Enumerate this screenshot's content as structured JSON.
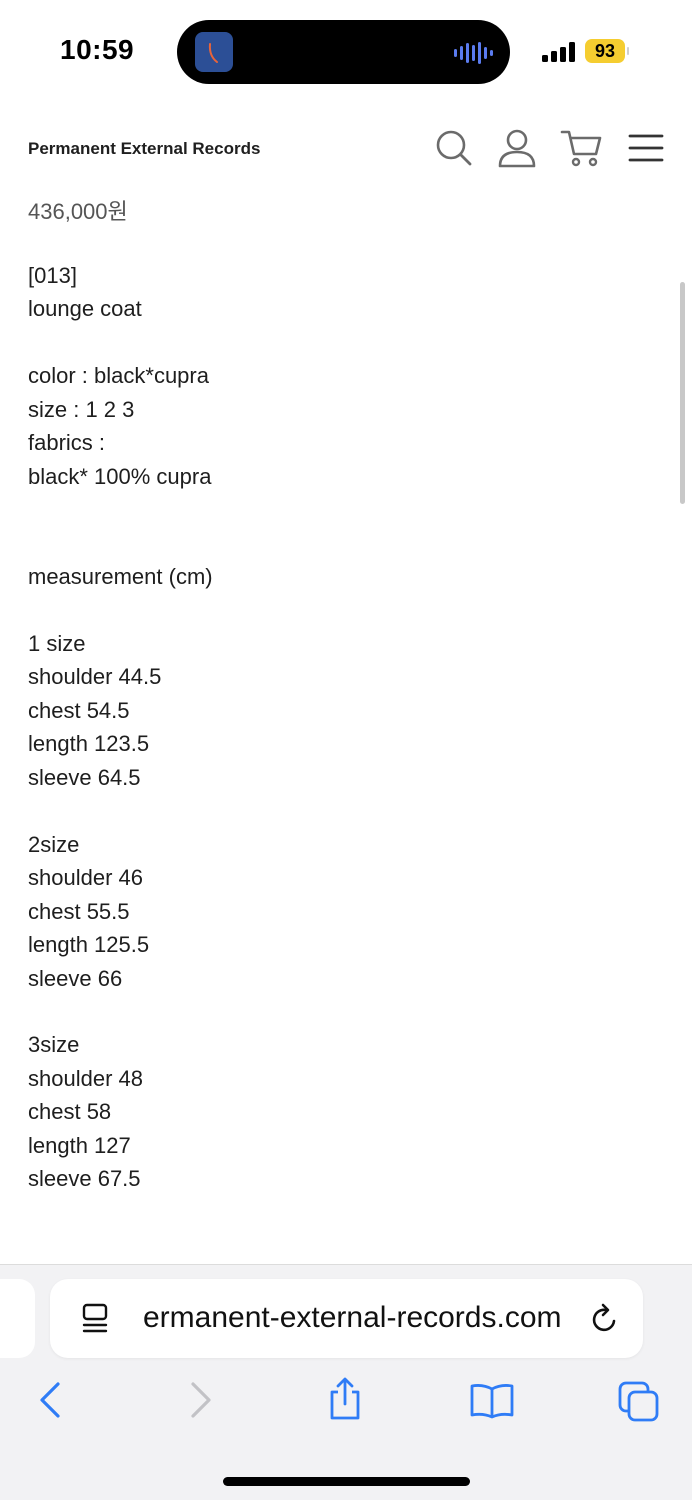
{
  "status_bar": {
    "time": "10:59",
    "battery": "93"
  },
  "header": {
    "brand": "Permanent External Records",
    "icons": [
      "search-icon",
      "account-icon",
      "cart-icon",
      "menu-icon"
    ]
  },
  "product": {
    "price": "436,000원",
    "code": "[013]",
    "name": "lounge coat",
    "color": "color : black*cupra",
    "size": "size : 1 2 3",
    "fabrics_label": "fabrics :",
    "fabrics": "black* 100% cupra",
    "measurement_title": "measurement (cm)",
    "size1": {
      "title": "1 size",
      "shoulder": "shoulder 44.5",
      "chest": "chest 54.5",
      "length": "length 123.5",
      "sleeve": "sleeve 64.5"
    },
    "size2": {
      "title": "2size",
      "shoulder": "shoulder 46",
      "chest": "chest 55.5",
      "length": "length 125.5",
      "sleeve": "sleeve 66"
    },
    "size3": {
      "title": "3size",
      "shoulder": "shoulder 48",
      "chest": "chest 58",
      "length": "length 127",
      "sleeve": "sleeve 67.5"
    }
  },
  "browser": {
    "url": "ermanent-external-records.com",
    "toolbar_icons": [
      "back-icon",
      "forward-icon",
      "share-icon",
      "bookmarks-icon",
      "tabs-icon"
    ]
  },
  "colors": {
    "ios_blue": "#2f7cf6",
    "battery": "#f5cd30",
    "icon_gray": "#6b6b6b"
  }
}
